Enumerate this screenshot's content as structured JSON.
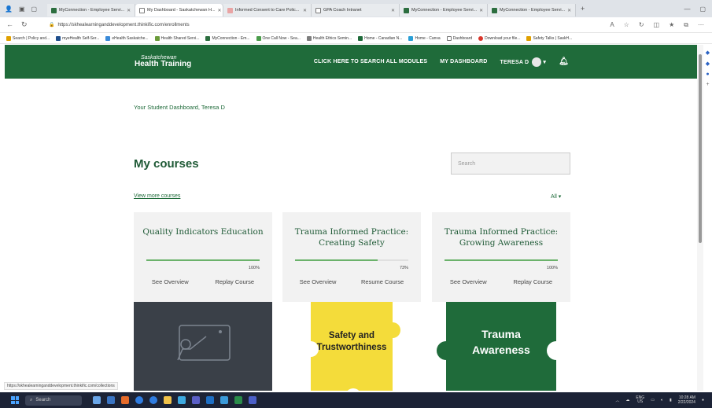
{
  "browser": {
    "tabs": [
      {
        "label": "MyConnection - Employee Servi...",
        "icon": "myconnection-icon",
        "active": false
      },
      {
        "label": "My Dashboard - Saskatchewan H...",
        "icon": "page-icon",
        "active": true
      },
      {
        "label": "Informed Consent to Care Polic...",
        "icon": "pdf-icon",
        "active": false
      },
      {
        "label": "GPA Coach Intranet",
        "icon": "page-icon",
        "active": false
      },
      {
        "label": "MyConnection - Employee Servi...",
        "icon": "myconnection-icon",
        "active": false
      },
      {
        "label": "MyConnection - Employee Servi...",
        "icon": "myconnection-icon",
        "active": false
      }
    ],
    "url": "https://skhealearninganddevelopment.thinkific.com/enrollments",
    "bookmarks": [
      "Search | Policy and...",
      "myeHealth Self-Ser...",
      "eHealth Saskatche...",
      "Health Shared Servi...",
      "MyConnection - Em...",
      "One Call Now - Sea...",
      "Health Ethics Semin...",
      "Home - Canadian N...",
      "Home - Canva",
      "Dashboard",
      "Download your file...",
      "Safety Talks | SaskH..."
    ],
    "status_url": "https://skhealearninganddevelopment.thinkific.com/collections"
  },
  "site": {
    "logo_top": "Saskatchewan",
    "logo_bottom": "Health Training",
    "nav_search": "CLICK HERE TO SEARCH ALL MODULES",
    "nav_dashboard": "MY DASHBOARD",
    "user_name": "TERESA D",
    "brand_color": "#1f6b3a"
  },
  "main": {
    "greeting": "Your Student Dashboard, Teresa D",
    "heading": "My courses",
    "search_placeholder": "Search",
    "view_more": "View more courses",
    "filter": "All",
    "courses": [
      {
        "title": "Quality Indicators Education",
        "progress": 100,
        "progress_label": "100%",
        "overview": "See Overview",
        "action": "Replay Course",
        "image": "presentation-icon"
      },
      {
        "title": "Trauma Informed Practice: Creating Safety",
        "progress": 73,
        "progress_label": "73%",
        "overview": "See Overview",
        "action": "Resume Course",
        "image_text_1": "Safety and",
        "image_text_2": "Trustworthiness"
      },
      {
        "title": "Trauma Informed Practice: Growing Awareness",
        "progress": 100,
        "progress_label": "100%",
        "overview": "See Overview",
        "action": "Replay Course",
        "image_text_1": "Trauma",
        "image_text_2": "Awareness"
      }
    ]
  },
  "taskbar": {
    "search": "Search",
    "lang": "ENG",
    "region": "US",
    "time": "10:28 AM",
    "date": "2/22/2024"
  }
}
